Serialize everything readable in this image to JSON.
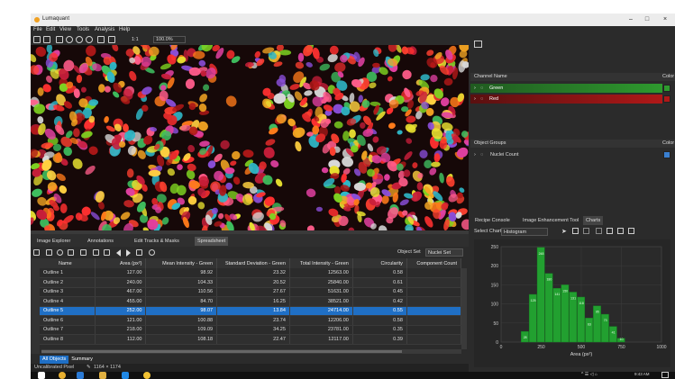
{
  "window": {
    "title": "Lumaquant",
    "minimize": "–",
    "maximize": "□",
    "close": "×"
  },
  "menu": [
    "File",
    "Edit",
    "View",
    "Tools",
    "Analysis",
    "Help"
  ],
  "toolbar": {
    "zoom_ratio": "1:1",
    "zoom_level": "100.0%"
  },
  "bottom_tabs": [
    "Image Explorer",
    "Annotations",
    "Edit Tracks & Masks",
    "Spreadsheet"
  ],
  "object_set": {
    "label": "Object Set",
    "value": "Nuclei Set"
  },
  "table": {
    "columns": [
      "Name",
      "Area (px²)",
      "Mean Intensity - Green",
      "Standard Deviation - Green",
      "Total Intensity - Green",
      "Circularity",
      "Component Count"
    ],
    "rows": [
      [
        "Outline 1",
        "127.00",
        "98.92",
        "23.32",
        "12563.00",
        "0.58",
        ""
      ],
      [
        "Outline 2",
        "240.00",
        "104.33",
        "20.52",
        "25840.00",
        "0.61",
        ""
      ],
      [
        "Outline 3",
        "467.00",
        "110.56",
        "27.67",
        "51631.00",
        "0.45",
        ""
      ],
      [
        "Outline 4",
        "455.00",
        "84.70",
        "16.25",
        "38521.00",
        "0.42",
        ""
      ],
      [
        "Outline 5",
        "252.00",
        "98.07",
        "13.84",
        "24714.00",
        "0.55",
        ""
      ],
      [
        "Outline 6",
        "121.00",
        "100.88",
        "23.74",
        "12206.00",
        "0.58",
        ""
      ],
      [
        "Outline 7",
        "218.00",
        "109.09",
        "34.25",
        "23781.00",
        "0.35",
        ""
      ],
      [
        "Outline 8",
        "112.00",
        "108.18",
        "22.47",
        "12117.00",
        "0.39",
        ""
      ]
    ],
    "selected_index": 4
  },
  "object_tabs": [
    "All Objects",
    "Summary"
  ],
  "status": {
    "calibration": "Uncalibrated Pixel",
    "size": "1164 × 1174"
  },
  "right_panel": {
    "channel_header": "Channel Name",
    "color_header": "Color",
    "channels": [
      {
        "name": "Green",
        "color": "#2e9a2e"
      },
      {
        "name": "Red",
        "color": "#b01818"
      }
    ],
    "groups_header": "Object Groups",
    "groups": [
      {
        "name": "Nuclei Count",
        "color": "#3a7fd0"
      }
    ],
    "tabs": [
      "Recipe Console",
      "Image Enhancement Tool",
      "Charts"
    ],
    "active_tab": 2,
    "select_chart_label": "Select Chart",
    "select_chart_value": "Histogram"
  },
  "chart_data": {
    "type": "bar",
    "title": "",
    "xlabel": "Area (px²)",
    "ylabel": "",
    "xlim": [
      0,
      1000
    ],
    "ylim": [
      0,
      250
    ],
    "xticks": [
      0,
      250,
      500,
      750,
      1000
    ],
    "yticks": [
      0,
      50,
      100,
      150,
      200,
      250
    ],
    "bin_width": 50,
    "bins": [
      {
        "x": 150,
        "value": 28
      },
      {
        "x": 200,
        "value": 125
      },
      {
        "x": 250,
        "value": 248
      },
      {
        "x": 300,
        "value": 180
      },
      {
        "x": 350,
        "value": 141
      },
      {
        "x": 400,
        "value": 150
      },
      {
        "x": 450,
        "value": 131
      },
      {
        "x": 500,
        "value": 118
      },
      {
        "x": 550,
        "value": 63
      },
      {
        "x": 600,
        "value": 95
      },
      {
        "x": 650,
        "value": 73
      },
      {
        "x": 700,
        "value": 41
      },
      {
        "x": 750,
        "value": 10
      }
    ],
    "data_labels": [
      "28",
      "125",
      "248",
      "180",
      "141",
      "150",
      "131",
      "118",
      "63",
      "95",
      "73",
      "41",
      "10"
    ],
    "color": "#22a030"
  },
  "taskbar": {
    "time": "9:43 AM",
    "date": "1/24/2018"
  }
}
